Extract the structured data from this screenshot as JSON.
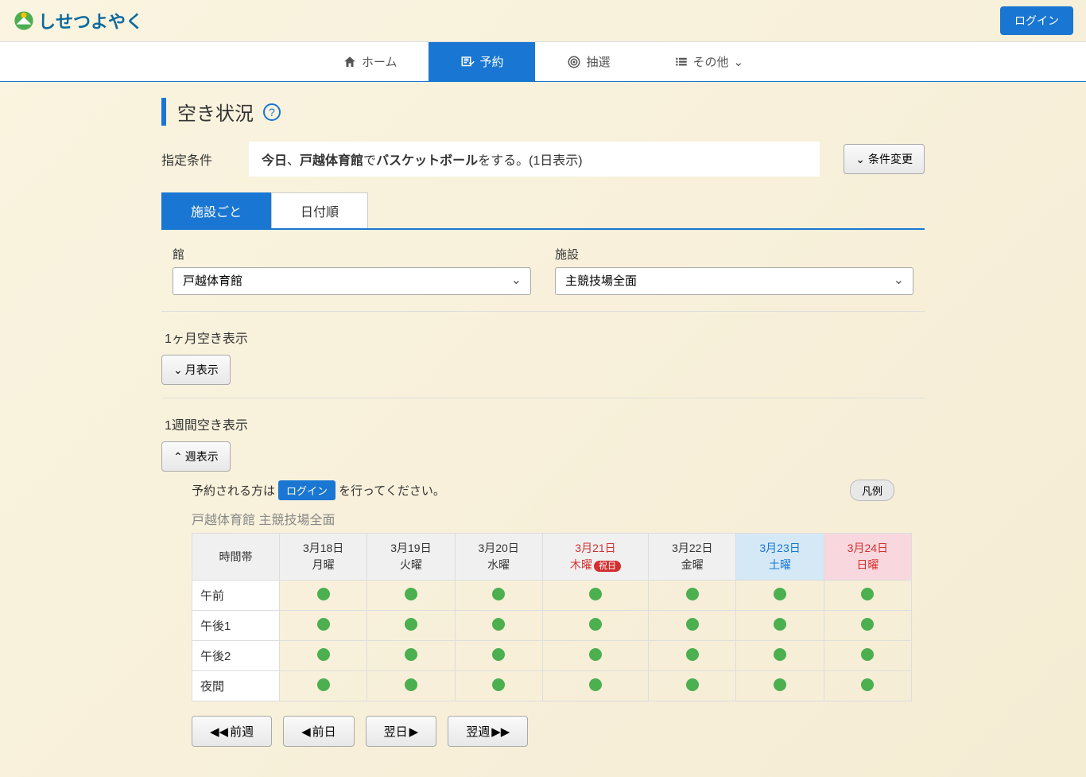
{
  "header": {
    "logo_text": "しせつよやく",
    "login_button": "ログイン"
  },
  "nav": {
    "home": "ホーム",
    "reserve": "予約",
    "lottery": "抽選",
    "other": "その他"
  },
  "page": {
    "title": "空き状況",
    "help": "?",
    "condition_label": "指定条件",
    "condition_prefix": "今日",
    "condition_sep1": "、",
    "condition_facility": "戸越体育館",
    "condition_sep2": "で",
    "condition_activity": "バスケットボール",
    "condition_suffix": "をする。(1日表示)",
    "change_button": "条件変更"
  },
  "tabs": {
    "by_facility": "施設ごと",
    "by_date": "日付順"
  },
  "selects": {
    "building_label": "館",
    "building_value": "戸越体育館",
    "facility_label": "施設",
    "facility_value": "主競技場全面"
  },
  "month": {
    "header": "1ヶ月空き表示",
    "toggle": "月表示"
  },
  "week": {
    "header": "1週間空き表示",
    "toggle": "週表示",
    "notice_prefix": "予約される方は",
    "notice_login": "ログイン",
    "notice_suffix": "を行ってください。",
    "legend": "凡例",
    "caption_building": "戸越体育館",
    "caption_facility": "主競技場全面"
  },
  "table": {
    "time_header": "時間帯",
    "days": [
      {
        "date": "3月18日",
        "dow": "月曜",
        "type": "normal"
      },
      {
        "date": "3月19日",
        "dow": "火曜",
        "type": "normal"
      },
      {
        "date": "3月20日",
        "dow": "水曜",
        "type": "normal"
      },
      {
        "date": "3月21日",
        "dow": "木曜",
        "type": "holiday",
        "badge": "祝日"
      },
      {
        "date": "3月22日",
        "dow": "金曜",
        "type": "normal"
      },
      {
        "date": "3月23日",
        "dow": "土曜",
        "type": "sat"
      },
      {
        "date": "3月24日",
        "dow": "日曜",
        "type": "sun"
      }
    ],
    "rows": [
      {
        "label": "午前",
        "cells": [
          "o",
          "o",
          "o",
          "o",
          "o",
          "o",
          "o"
        ]
      },
      {
        "label": "午後1",
        "cells": [
          "o",
          "o",
          "o",
          "o",
          "o",
          "o",
          "o"
        ]
      },
      {
        "label": "午後2",
        "cells": [
          "o",
          "o",
          "o",
          "o",
          "o",
          "o",
          "o"
        ]
      },
      {
        "label": "夜間",
        "cells": [
          "o",
          "o",
          "o",
          "o",
          "o",
          "o",
          "o"
        ]
      }
    ]
  },
  "navbuttons": {
    "prev_week": "前週",
    "prev_day": "前日",
    "next_day": "翌日",
    "next_week": "翌週"
  }
}
